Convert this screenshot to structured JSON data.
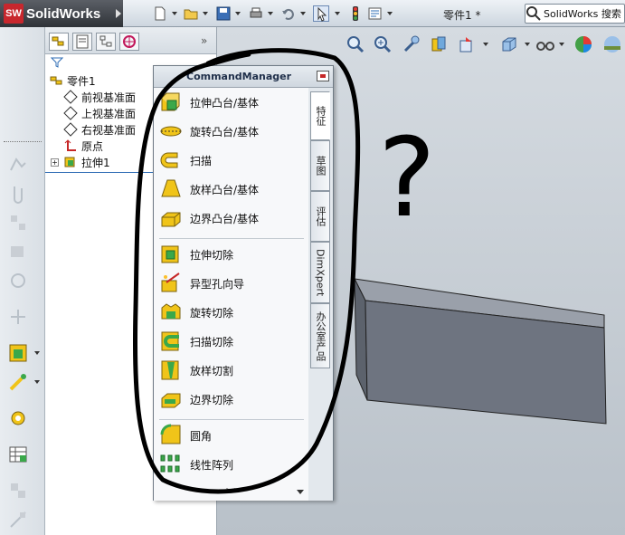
{
  "app": {
    "brand": "SolidWorks",
    "logo_text": "SW",
    "document_title": "零件1 *",
    "search_text": "SolidWorks 搜索"
  },
  "feature_tree": {
    "part_name": "零件1",
    "items": [
      {
        "label": "前视基准面",
        "icon": "plane-icon"
      },
      {
        "label": "上视基准面",
        "icon": "plane-icon"
      },
      {
        "label": "右视基准面",
        "icon": "plane-icon"
      },
      {
        "label": "原点",
        "icon": "origin-icon"
      },
      {
        "label": "拉伸1",
        "icon": "extrude-feature-icon"
      }
    ]
  },
  "command_manager": {
    "title": "CommandManager",
    "tools": [
      {
        "label": "拉伸凸台/基体",
        "icon": "extruded-boss-icon"
      },
      {
        "label": "旋转凸台/基体",
        "icon": "revolved-boss-icon"
      },
      {
        "label": "扫描",
        "icon": "swept-boss-icon"
      },
      {
        "label": "放样凸台/基体",
        "icon": "lofted-boss-icon"
      },
      {
        "label": "边界凸台/基体",
        "icon": "boundary-boss-icon"
      },
      {
        "label": "拉伸切除",
        "icon": "extruded-cut-icon"
      },
      {
        "label": "异型孔向导",
        "icon": "hole-wizard-icon"
      },
      {
        "label": "旋转切除",
        "icon": "revolved-cut-icon"
      },
      {
        "label": "扫描切除",
        "icon": "swept-cut-icon"
      },
      {
        "label": "放样切割",
        "icon": "lofted-cut-icon"
      },
      {
        "label": "边界切除",
        "icon": "boundary-cut-icon"
      },
      {
        "label": "圆角",
        "icon": "fillet-icon"
      },
      {
        "label": "线性阵列",
        "icon": "linear-pattern-icon"
      }
    ],
    "tabs": [
      {
        "label": "特征",
        "active": true
      },
      {
        "label": "草图",
        "active": false
      },
      {
        "label": "评估",
        "active": false
      },
      {
        "label": "DimXpert",
        "active": false
      },
      {
        "label": "办公室产品",
        "active": false
      }
    ]
  },
  "overlay": {
    "question_mark": "?"
  },
  "colors": {
    "accent": "#c8272d",
    "feature_yellow": "#f0c419",
    "feature_green": "#3aa84a",
    "model_gray": "#6e7480"
  }
}
